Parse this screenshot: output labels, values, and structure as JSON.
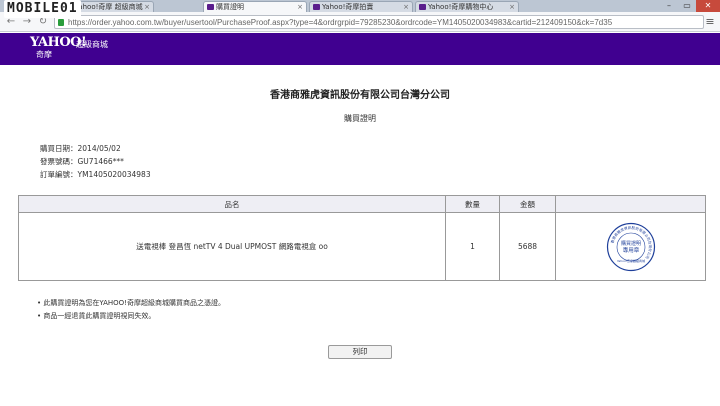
{
  "browser": {
    "tabs": [
      {
        "label": "Yahoo!奇摩 超級商城"
      },
      {
        "label": "購買證明"
      },
      {
        "label": "Yahoo!奇摩拍賣"
      },
      {
        "label": "Yahoo!奇摩購物中心"
      }
    ],
    "url": "https://order.yahoo.com.tw/buyer/usertool/PurchaseProof.aspx?type=4&ordrgrpid=79285230&ordrcode=YM1405020034983&cartid=212409150&ck=7d35",
    "watermark": "MOBILE01"
  },
  "header": {
    "logo": "YAHOO!",
    "logo_sub": "奇摩",
    "mall": "超級商城"
  },
  "document": {
    "company": "香港商雅虎資訊股份有限公司台灣分公司",
    "title": "購買證明",
    "purchase_date": "購買日期：2014/05/02",
    "invoice_no": "發票號碼：GU71466***",
    "order_no": "訂單編號：YM1405020034983"
  },
  "table": {
    "headers": [
      "品名",
      "數量",
      "金額",
      ""
    ],
    "rows": [
      {
        "name": "送電視棒 登昌恆 netTV 4 Dual UPMOST 網路電視盒 oo",
        "qty": "1",
        "amount": "5688"
      }
    ]
  },
  "seal": {
    "ring": "香港商雅虎資訊股份有限公司台灣分公司",
    "line1": "購買證明",
    "line2": "專用章",
    "bottom": "Yahoo!奇摩超級商城"
  },
  "notes": [
    "此購買證明為您在YAHOO!奇摩超級商城購買商品之憑證。",
    "商品一經退貨此購買證明視同失效。"
  ],
  "print_label": "列印"
}
